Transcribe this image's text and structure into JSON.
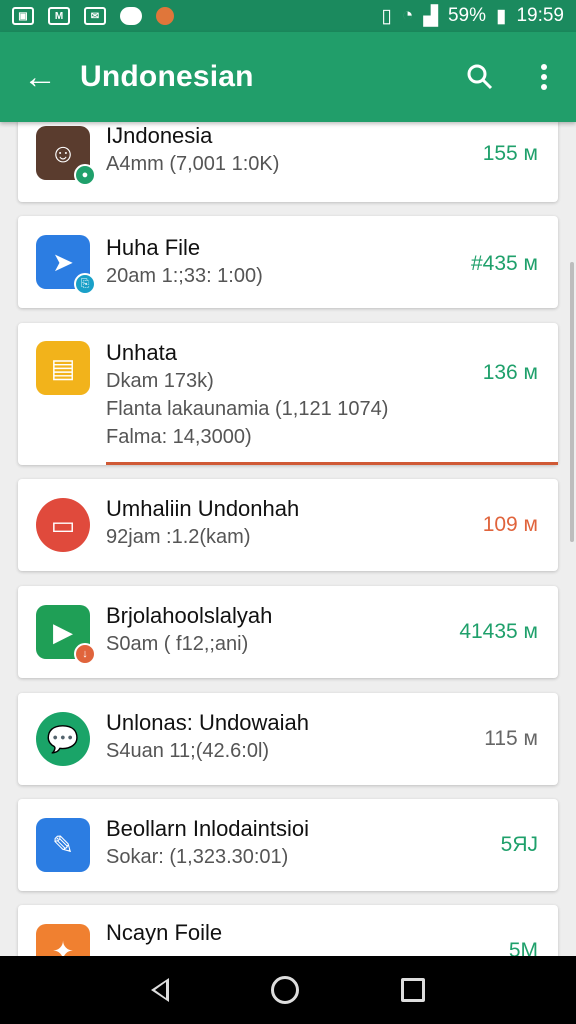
{
  "status_bar": {
    "battery": "59%",
    "time": "19:59",
    "icons": [
      "gallery-icon",
      "photo-icon",
      "message-icon",
      "game-icon",
      "avatar-icon"
    ]
  },
  "app_bar": {
    "title": "Undonesian",
    "back_icon": "arrow-back-icon",
    "search_icon": "search-icon",
    "menu_icon": "overflow-menu-icon"
  },
  "items": [
    {
      "name": "IJndonesia",
      "line1": "A4mm (7,001 1:0K)",
      "line2": "",
      "line3": "",
      "size": "155 м",
      "size_color": "#1fa06b",
      "icon_color": "#5a3c2e",
      "icon": "profile-photo-icon"
    },
    {
      "name": "Huha File",
      "line1": "20am 1:;33: 1:00)",
      "line2": "",
      "line3": "",
      "size": "#435 м",
      "size_color": "#1fa06b",
      "icon_color": "#2c7de2",
      "icon": "send-icon"
    },
    {
      "name": "Unhata",
      "line1": "Dkam 173k)",
      "line2": "Flanta lakaunamia (1,121 1074)",
      "line3": "Falma: 14,3000)",
      "size": "136 м",
      "size_color": "#1fa06b",
      "icon_color": "#f2b31b",
      "icon": "notepad-icon"
    },
    {
      "name": "Umhaliin Undonhah",
      "line1": "92jam :1.2(kam)",
      "line2": "",
      "line3": "",
      "size": "109 м",
      "size_color": "#e0643c",
      "icon_color": "#e04a3c",
      "icon": "folder-icon"
    },
    {
      "name": "Brjolahoolslalyah",
      "line1": "S0am ( f12,;ani)",
      "line2": "",
      "line3": "",
      "size": "41435 м",
      "size_color": "#1fa06b",
      "icon_color": "#1f9f56",
      "icon": "play-icon"
    },
    {
      "name": "Unlonas: Undowaiah",
      "line1": "S4uan 11;(42.6:0l)",
      "line2": "",
      "line3": "",
      "size": "115 м",
      "size_color": "#666666",
      "icon_color": "#1aa468",
      "icon": "chat-icon"
    },
    {
      "name": "Beollarn Inlodaintsioi",
      "line1": "Sokar: (1,323.30:01)",
      "line2": "",
      "line3": "",
      "size": "5ЯJ",
      "size_color": "#1fa06b",
      "icon_color": "#2c7de2",
      "icon": "wrench-icon"
    },
    {
      "name": "Ncayn Foile",
      "line1": "",
      "line2": "",
      "line3": "",
      "size": "5M",
      "size_color": "#1fa06b",
      "icon_color": "#f08030",
      "icon": "puzzle-icon"
    }
  ]
}
